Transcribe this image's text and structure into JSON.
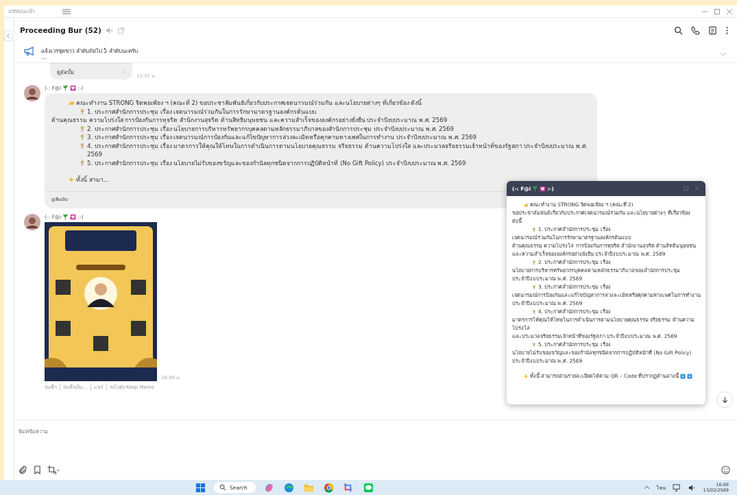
{
  "top_bar": {
    "title": "แชทแนะนำ"
  },
  "chat_header": {
    "title": "Proceeding Bur (52)"
  },
  "announcement": {
    "text": "แจ้งเวรชุดขาว ลำดับถัดไป 5 ลำดับนะครับ",
    "more": "..."
  },
  "messages": [
    {
      "kind": "album",
      "label": "ดูอัลบั้ม",
      "time": "15.57 น."
    },
    {
      "kind": "text",
      "sender": {
        "name": "(-: F@i",
        "tail": ":-)"
      },
      "lines": [
        {
          "kind": "intro",
          "text": "คณะทำงาน STRONG จิตพอเพียง ฯ (คณะที่ 2) ขอประชาสัมพันธ์เกี่ยวกับประกาศเจตนารมณ์ร่วมกัน และนโยบายต่างๆ ที่เกี่ยวข้อง ดังนี้"
        },
        {
          "kind": "item",
          "text": "1. ประกาศสำนักการประชุม เรื่อง เจตนารมณ์ร่วมกันในการรักษามาตรฐานองค์กรต้นแบบ"
        },
        {
          "kind": "plain",
          "text": "ด้านคุณธรรม ความโปร่งใส การป้องกันการทุจริต สำนักงานสุจริต ด้านสิทธิมนุษยชน และความสำเร็จขององค์กรอย่างยั่งยืน ประจำปีงบประมาณ พ.ศ. 2569"
        },
        {
          "kind": "item",
          "text": "2. ประกาศสำนักการประชุม เรื่อง  นโยบายการบริหารทรัพยากรบุคคลตามหลักธรรมาภิบาลของสำนักการประชุม ประจำปีงบประมาณ พ.ศ. 2569"
        },
        {
          "kind": "item",
          "text": "3. ประกาศสำนักการประชุม เรื่อง  เจตนารมณ์การป้องกันและแก้ไขปัญหาการล่วงละเมิดหรือคุกคามทางเพศในการทำงาน ประจำปีงบประมาณ พ.ศ. 2569"
        },
        {
          "kind": "item",
          "text": "4. ประกาศสำนักการประชุม เรื่อง  มาตรการให้คุณให้โทษในการดำเนินการตามนโยบายคุณธรรม จริยธรรม ด้านความโปร่งใส และประมวลจริยธรรมเจ้าหน้าที่ของรัฐสภา ประจำปีงบประมาณ พ.ศ. 2569"
        },
        {
          "kind": "item",
          "text": "5. ประกาศสำนักการประชุม เรื่อง  นโยบายไม่รับของขวัญและของกำนัลทุกชนิดจากการปฏิบัติหน้าที่ (No Gift Policy) ประจำปีงบประมาณ พ.ศ. 2569"
        },
        {
          "kind": "teaser",
          "text": "ทั้งนี้ สามา..."
        }
      ],
      "more": "ดูเพิ่มเติม"
    },
    {
      "sender": {
        "name": "(-: F@i",
        "tail": ":-)"
      },
      "time": "16.00 น.",
      "actions": [
        "บันทึก",
        "บันทึกเป็น...",
        "แชร์",
        "ส่งไปยัง Keep Memo"
      ]
    }
  ],
  "popup": {
    "sender": {
      "name": "(-: F@i",
      "tail": ":-)"
    },
    "lines": [
      {
        "kind": "intro",
        "text": "คณะทำงาน STRONG จิตพอเพียง ฯ (คณะที่ 2)"
      },
      {
        "kind": "plain",
        "text": "ขอประชาสัมพันธ์เกี่ยวกับประกาศเจตนารมณ์ร่วมกัน และนโยบายต่างๆ ที่เกี่ยวข้อง ดังนี้"
      },
      {
        "kind": "item",
        "text": "1. ประกาศสำนักการประชุม เรื่อง"
      },
      {
        "kind": "plain",
        "text": "เจตนารมณ์ร่วมกันในการรักษามาตรฐานองค์กรต้นแบบ"
      },
      {
        "kind": "plain",
        "text": "ด้านคุณธรรม ความโปร่งใส การป้องกันการทุจริต สำนักงานสุจริต ด้านสิทธิมนุษยชน"
      },
      {
        "kind": "plain",
        "text": "และความสำเร็จขององค์กรอย่างยั่งยืน ประจำปีงบประมาณ พ.ศ. 2569"
      },
      {
        "kind": "item",
        "text": "2. ประกาศสำนักการประชุม เรื่อง"
      },
      {
        "kind": "plain",
        "text": "นโยบายการบริหารทรัพยากรบุคคลตามหลักธรรมาภิบาลของสำนักการประชุม"
      },
      {
        "kind": "plain",
        "text": "ประจำปีงบประมาณ พ.ศ. 2569"
      },
      {
        "kind": "item",
        "text": "3. ประกาศสำนักการประชุม เรื่อง"
      },
      {
        "kind": "plain",
        "text": "เจตนารมณ์การป้องกันและแก้ไขปัญหาการล่วงละเมิดหรือคุกคามทางเพศในการทำงาน"
      },
      {
        "kind": "plain",
        "text": "ประจำปีงบประมาณ พ.ศ. 2569"
      },
      {
        "kind": "item",
        "text": "4. ประกาศสำนักการประชุม เรื่อง"
      },
      {
        "kind": "plain",
        "text": "มาตรการให้คุณให้โทษในการดำเนินการตามนโยบายคุณธรรม จริยธรรม ด้านความโปร่งใส"
      },
      {
        "kind": "plain",
        "text": "และประมวลจริยธรรมเจ้าหน้าที่ของรัฐสภา ประจำปีงบประมาณ พ.ศ. 2569"
      },
      {
        "kind": "item",
        "text": "5. ประกาศสำนักการประชุม เรื่อง"
      },
      {
        "kind": "plain",
        "text": "นโยบายไม่รับของขวัญและของกำนัลทุกชนิดจากการปฏิบัติหน้าที่ (No Gift Policy)"
      },
      {
        "kind": "plain",
        "text": "ประจำปีงบประมาณ พ.ศ. 2569"
      },
      {
        "kind": "closing",
        "text": "ทั้งนี้ สามารถอ่านรายละเอียดได้ตาม QR – Code ที่ปรากฏด้านล่างนี้"
      }
    ]
  },
  "composer": {
    "placeholder": "พิมพ์ข้อความ"
  },
  "taskbar": {
    "search": "Search",
    "language": "ไทย",
    "time": "16:09",
    "date": "13/02/2569"
  }
}
